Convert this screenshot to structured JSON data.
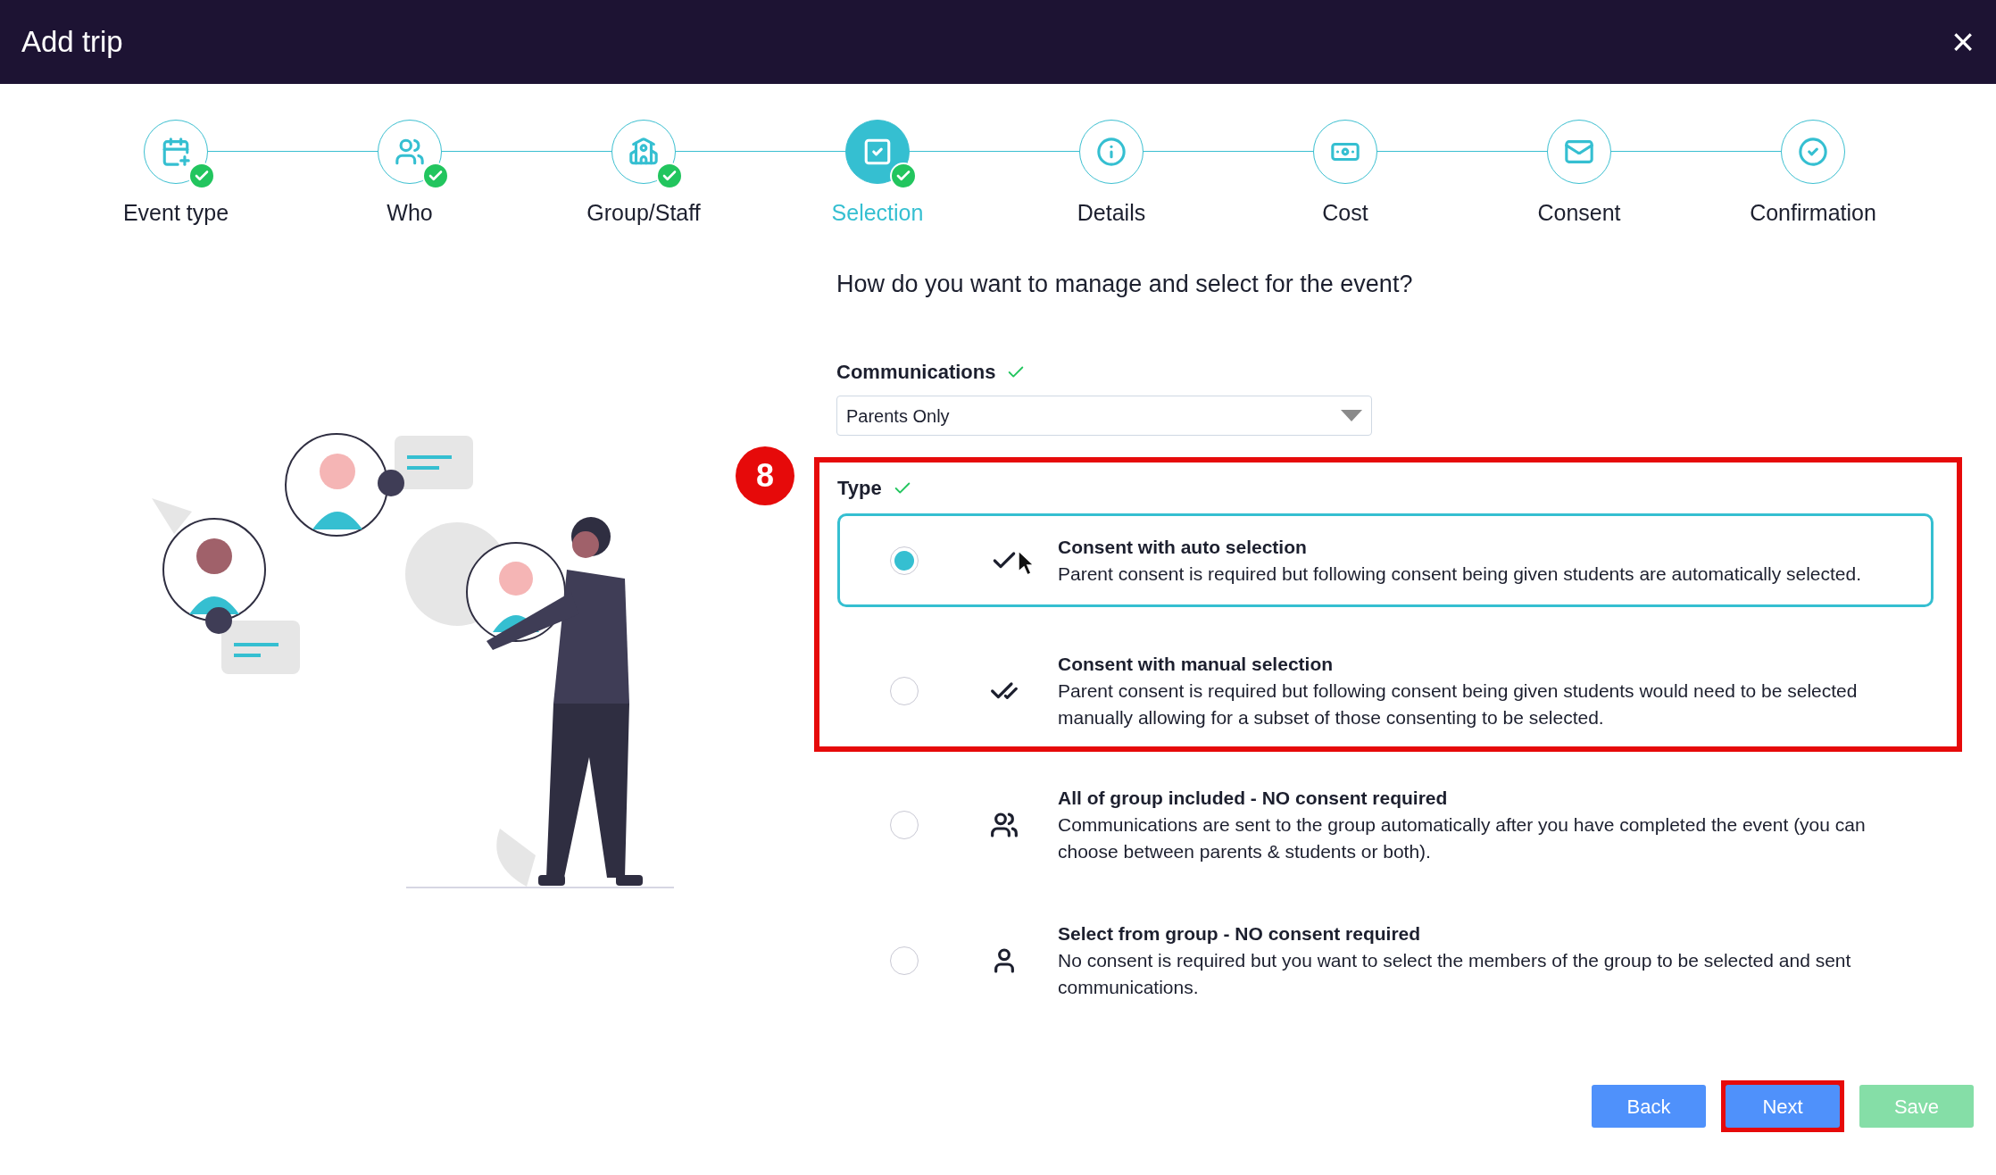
{
  "window": {
    "title": "Add trip",
    "close": "×"
  },
  "steps": [
    {
      "label": "Event type",
      "completed": true,
      "selected": false
    },
    {
      "label": "Who",
      "completed": true,
      "selected": false
    },
    {
      "label": "Group/Staff",
      "completed": true,
      "selected": false
    },
    {
      "label": "Selection",
      "completed": true,
      "selected": true
    },
    {
      "label": "Details",
      "completed": false,
      "selected": false
    },
    {
      "label": "Cost",
      "completed": false,
      "selected": false
    },
    {
      "label": "Consent",
      "completed": false,
      "selected": false
    },
    {
      "label": "Confirmation",
      "completed": false,
      "selected": false
    }
  ],
  "question": "How do you want to manage and select for the event?",
  "communications": {
    "label": "Communications",
    "checked": true,
    "value": "Parents Only"
  },
  "annotation": {
    "number": "8"
  },
  "type": {
    "label": "Type",
    "checked": true,
    "options": [
      {
        "title": "Consent with auto selection",
        "description": "Parent consent is required but following consent being given students are automatically selected.",
        "selected": true,
        "highlighted": true
      },
      {
        "title": "Consent with manual selection",
        "description": "Parent consent is required but following consent being given students would need to be selected manually allowing for a subset of those consenting to be selected.",
        "selected": false,
        "highlighted": true
      },
      {
        "title": "All of group included - NO consent required",
        "description": "Communications are sent to the group automatically after you have completed the event (you can choose between parents & students or both).",
        "selected": false,
        "highlighted": false
      },
      {
        "title": "Select from group - NO consent required",
        "description": "No consent is required but you want to select the members of the group to be selected and sent communications.",
        "selected": false,
        "highlighted": false
      }
    ]
  },
  "buttons": [
    {
      "label": "Back",
      "kind": "primary",
      "highlighted": false
    },
    {
      "label": "Next",
      "kind": "primary",
      "highlighted": true
    },
    {
      "label": "Save",
      "kind": "success",
      "highlighted": false
    }
  ]
}
